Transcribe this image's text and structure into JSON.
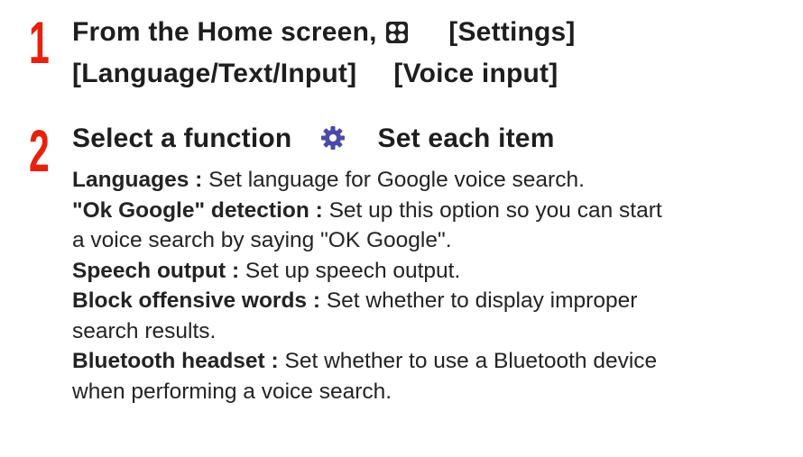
{
  "step1": {
    "number": "1",
    "line1_part1": "From the Home screen,",
    "apps_icon": "apps-grid-icon",
    "line1_part2": "[Settings]",
    "line2_part1": "[Language/Text/Input]",
    "line2_part2": "[Voice input]"
  },
  "step2": {
    "number": "2",
    "heading_part1": "Select a function",
    "gear_icon": "gear-icon",
    "heading_part2": "Set each item",
    "items": [
      {
        "term": "Languages :",
        "text": "Set language for Google voice search."
      },
      {
        "term": "\"Ok Google\" detection :",
        "text": "Set up this option so you can start",
        "text_cont": "a voice search by saying \"OK Google\"."
      },
      {
        "term": "Speech output :",
        "text": "Set up speech output."
      },
      {
        "term": "Block offensive words :",
        "text": "Set whether to display improper",
        "text_cont": "search results."
      },
      {
        "term": "Bluetooth headset :",
        "text": "Set whether to use a Bluetooth device",
        "text_cont": "when performing a voice search."
      }
    ]
  },
  "colors": {
    "step_number": "#e8200c",
    "text": "#1e1e1e",
    "gear_icon": "#4a4aa8"
  }
}
